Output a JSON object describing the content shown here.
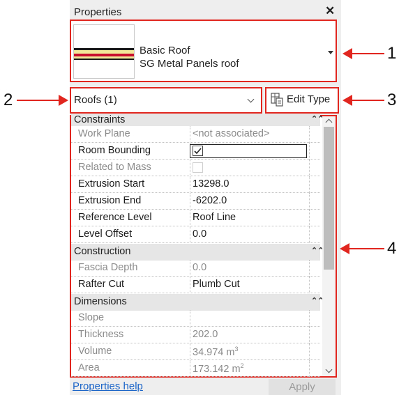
{
  "panel": {
    "title": "Properties",
    "close_glyph": "✕"
  },
  "type_selector": {
    "line1": "Basic Roof",
    "line2": "SG Metal Panels roof"
  },
  "category": {
    "label": "Roofs (1)"
  },
  "edit_type": {
    "label": "Edit Type"
  },
  "groups": {
    "constraints": "Constraints",
    "construction": "Construction",
    "dimensions": "Dimensions"
  },
  "rows": {
    "work_plane": {
      "name": "Work Plane",
      "value": "<not associated>"
    },
    "room_bounding": {
      "name": "Room Bounding",
      "checked": true
    },
    "related_to_mass": {
      "name": "Related to Mass",
      "checked": false
    },
    "extrusion_start": {
      "name": "Extrusion Start",
      "value": "13298.0"
    },
    "extrusion_end": {
      "name": "Extrusion End",
      "value": "-6202.0"
    },
    "reference_level": {
      "name": "Reference Level",
      "value": "Roof Line"
    },
    "level_offset": {
      "name": "Level Offset",
      "value": "0.0"
    },
    "fascia_depth": {
      "name": "Fascia Depth",
      "value": "0.0"
    },
    "rafter_cut": {
      "name": "Rafter Cut",
      "value": "Plumb Cut"
    },
    "slope": {
      "name": "Slope",
      "value": ""
    },
    "thickness": {
      "name": "Thickness",
      "value": "202.0"
    },
    "volume": {
      "name": "Volume",
      "value": "34.974 m",
      "unit_exp": "3"
    },
    "area": {
      "name": "Area",
      "value": "173.142 m",
      "unit_exp": "2"
    }
  },
  "footer": {
    "help": "Properties help",
    "apply": "Apply"
  },
  "callouts": {
    "c1": "1",
    "c2": "2",
    "c3": "3",
    "c4": "4"
  },
  "colors": {
    "callout": "#e0261f",
    "link": "#1a64c8"
  }
}
